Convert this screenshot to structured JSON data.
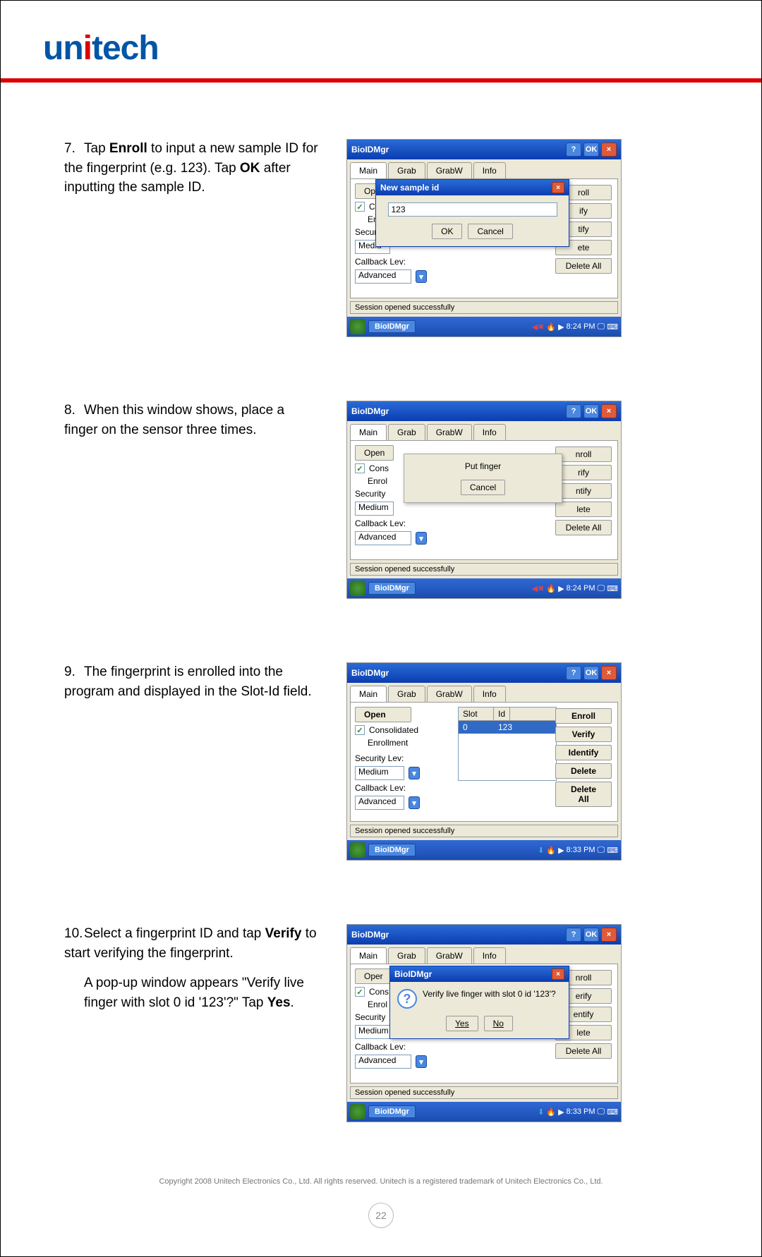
{
  "logo_pre": "un",
  "logo_post": "tech",
  "steps": {
    "s7": {
      "num": "7.",
      "t1": "Tap ",
      "b1": "Enroll",
      "t2": " to input a new sample ID for the fingerprint (e.g. 123). Tap ",
      "b2": "OK",
      "t3": " after inputting the sample ID."
    },
    "s8": {
      "num": "8.",
      "t1": "When this window shows, place a finger on the sensor three times."
    },
    "s9": {
      "num": "9.",
      "t1": "The fingerprint is enrolled into the program and displayed in the Slot-Id field."
    },
    "s10": {
      "num": "10.",
      "t1": "Select a fingerprint ID and tap ",
      "b1": "Verify",
      "t2": " to start verifying the fingerprint.",
      "p2a": "A pop-up window appears \"Verify live finger with slot 0 id '123'?\" Tap ",
      "p2b": "Yes",
      "p2c": "."
    }
  },
  "ss": {
    "title": "BioIDMgr",
    "tabs": {
      "main": "Main",
      "grab": "Grab",
      "grabw": "GrabW",
      "info": "Info"
    },
    "btns": {
      "open": "Open",
      "enroll": "Enroll",
      "verify": "Verify",
      "identify": "Identify",
      "delete": "Delete",
      "deleteall": "Delete All",
      "ok": "OK",
      "cancel": "Cancel",
      "yes": "Yes",
      "no": "No"
    },
    "lbls": {
      "cons": "Consolidated",
      "enr": "Enrollment",
      "sec": "Security Lev:",
      "cb": "Callback Lev:",
      "medium": "Medium",
      "advanced": "Advanced",
      "slot": "Slot",
      "id": "Id"
    },
    "partial": {
      "op": "Op",
      "co": "Co",
      "en": "En",
      "securl": "Securl",
      "mediu": "Mediu",
      "cons": "Cons",
      "enrol": "Enrol",
      "security": "Security",
      "medium2": "Medium",
      "oper": "Oper",
      "roll": "roll",
      "ify": "ify",
      "tify": "tify",
      "ete": "ete",
      "nroll": "nroll",
      "rify": "rify",
      "ntify": "ntify",
      "lete": "lete",
      "erify": "erify",
      "entify": "entify",
      "open2": "Open"
    },
    "status": "Session opened successfully",
    "task_app": "BioIDMgr",
    "time1": "8:24 PM",
    "time2": "8:33 PM",
    "callback_cut": "Callback Lev:",
    "rowslot": "0",
    "rowid": "123"
  },
  "dlg1": {
    "title": "New sample id",
    "val": "123"
  },
  "dlg2": {
    "msg": "Put finger"
  },
  "dlg4": {
    "title": "BioIDMgr",
    "msg": "Verify live finger with slot 0 id '123'?"
  },
  "copyright": "Copyright 2008 Unitech Electronics Co., Ltd. All rights reserved. Unitech is a registered trademark of Unitech Electronics Co., Ltd.",
  "page_num": "22"
}
